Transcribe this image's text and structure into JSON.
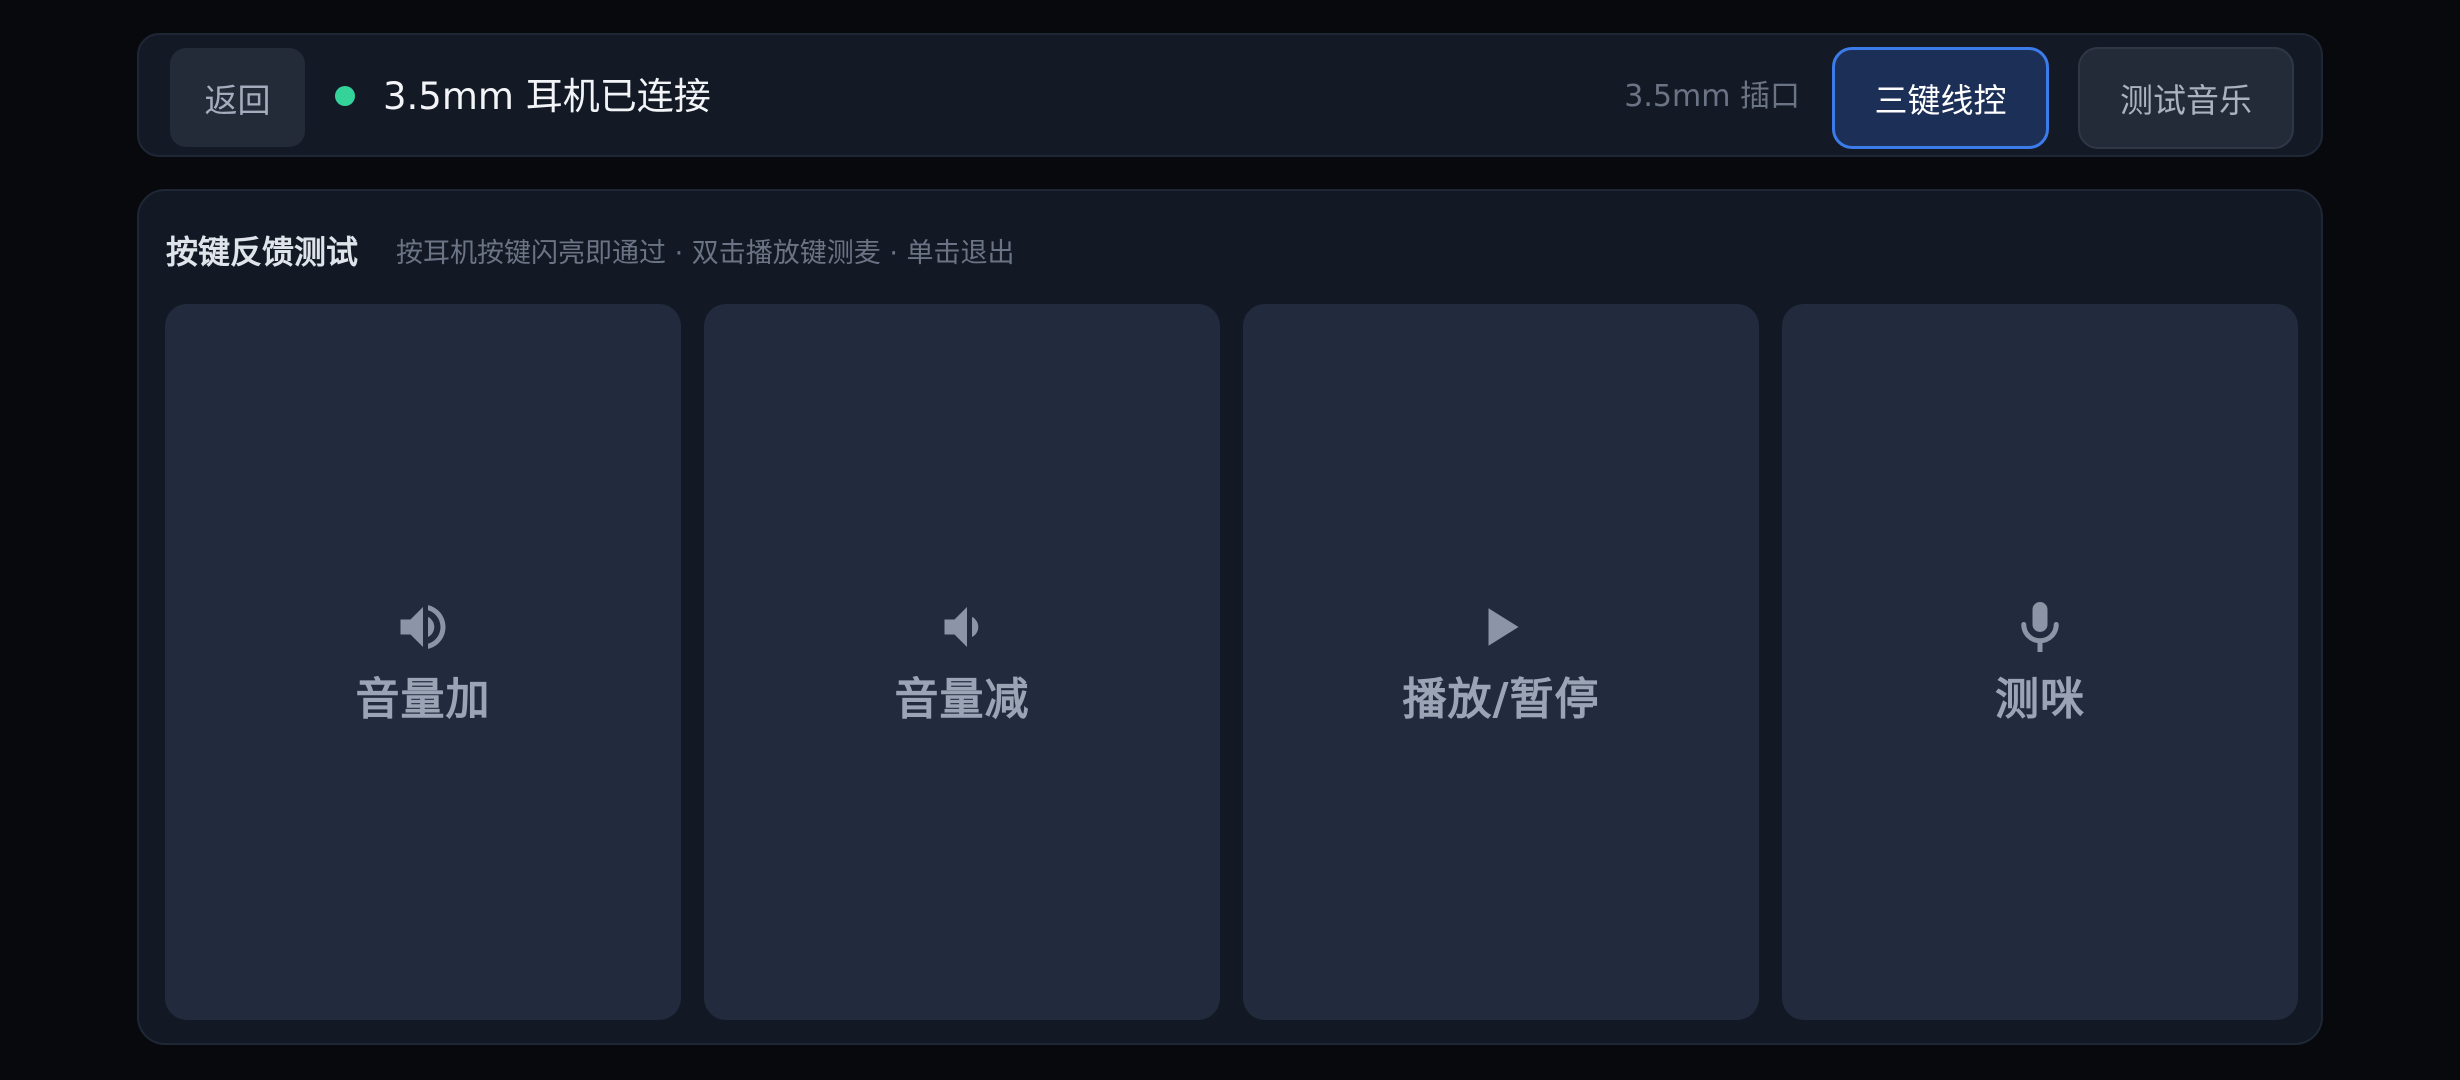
{
  "topbar": {
    "back_label": "返回",
    "status_text": "3.5mm 耳机已连接",
    "status_color": "#34d399",
    "port_label": "3.5mm 插口",
    "mode_button_label": "三键线控",
    "music_button_label": "测试音乐"
  },
  "panel": {
    "title": "按键反馈测试",
    "hint": "按耳机按键闪亮即通过 · 双击播放键测麦 · 单击退出",
    "keys": [
      {
        "label": "音量加",
        "icon": "volume-up-icon"
      },
      {
        "label": "音量减",
        "icon": "volume-down-icon"
      },
      {
        "label": "播放/暂停",
        "icon": "play-icon"
      },
      {
        "label": "测咪",
        "icon": "microphone-icon"
      }
    ]
  },
  "colors": {
    "accent": "#3b7bea",
    "card": "#222b3d",
    "icon": "#8c95a6"
  }
}
